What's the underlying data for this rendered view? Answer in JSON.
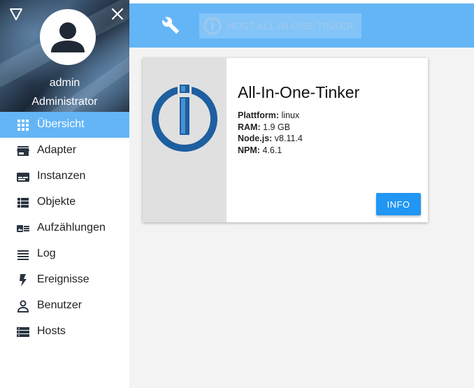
{
  "sidebar": {
    "user": {
      "name": "admin",
      "role": "Administrator"
    },
    "items": [
      {
        "label": "Übersicht",
        "icon": "grid-icon",
        "active": true
      },
      {
        "label": "Adapter",
        "icon": "store-icon"
      },
      {
        "label": "Instanzen",
        "icon": "instances-icon"
      },
      {
        "label": "Objekte",
        "icon": "list-icon"
      },
      {
        "label": "Aufzählungen",
        "icon": "enums-icon"
      },
      {
        "label": "Log",
        "icon": "log-icon"
      },
      {
        "label": "Ereignisse",
        "icon": "flash-icon"
      },
      {
        "label": "Benutzer",
        "icon": "user-icon"
      },
      {
        "label": "Hosts",
        "icon": "hosts-icon"
      }
    ]
  },
  "topbar": {
    "host_label": "HOST ALL-IN-ONE-TINKER"
  },
  "card": {
    "title": "All-In-One-Tinker",
    "info": [
      {
        "key": "Plattform:",
        "value": "linux"
      },
      {
        "key": "RAM:",
        "value": "1.9 GB"
      },
      {
        "key": "Node.js:",
        "value": "v8.11.4"
      },
      {
        "key": "NPM:",
        "value": "4.6.1"
      }
    ],
    "button_label": "INFO"
  },
  "colors": {
    "accent": "#64b5f6",
    "button": "#2196f3",
    "logo": "#1d5fa0"
  }
}
